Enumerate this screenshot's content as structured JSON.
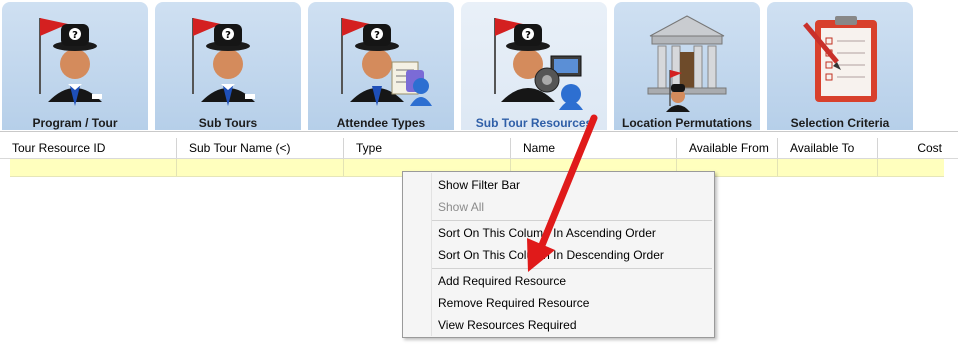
{
  "tabs": [
    {
      "label": "Program / Tour",
      "icon": "tour-guide-icon",
      "active": false
    },
    {
      "label": "Sub Tours",
      "icon": "tour-guide-icon",
      "active": false
    },
    {
      "label": "Attendee Types",
      "icon": "attendee-types-icon",
      "active": false
    },
    {
      "label": "Sub Tour Resources",
      "icon": "resources-icon",
      "active": true
    },
    {
      "label": "Location Permutations",
      "icon": "building-icon",
      "active": false
    },
    {
      "label": "Selection Criteria",
      "icon": "clipboard-checklist-icon",
      "active": false
    }
  ],
  "grid": {
    "columns": [
      "Tour Resource ID",
      "Sub Tour Name (<)",
      "Type",
      "Name",
      "Available From",
      "Available To",
      "Cost"
    ]
  },
  "context_menu": {
    "items": [
      {
        "label": "Show Filter Bar",
        "enabled": true
      },
      {
        "label": "Show All",
        "enabled": false
      },
      {
        "label": "Sort On This Column In Ascending Order",
        "enabled": true
      },
      {
        "label": "Sort On This Column In Descending Order",
        "enabled": true
      },
      {
        "label": "Add Required Resource",
        "enabled": true
      },
      {
        "label": "Remove Required Resource",
        "enabled": true
      },
      {
        "label": "View Resources Required",
        "enabled": true
      }
    ]
  },
  "colors": {
    "tab_bg": "#b6cfe9",
    "tab_active_label": "#2f5fa8",
    "filter_row": "#ffffbe",
    "annotation_arrow": "#e01a1a"
  }
}
